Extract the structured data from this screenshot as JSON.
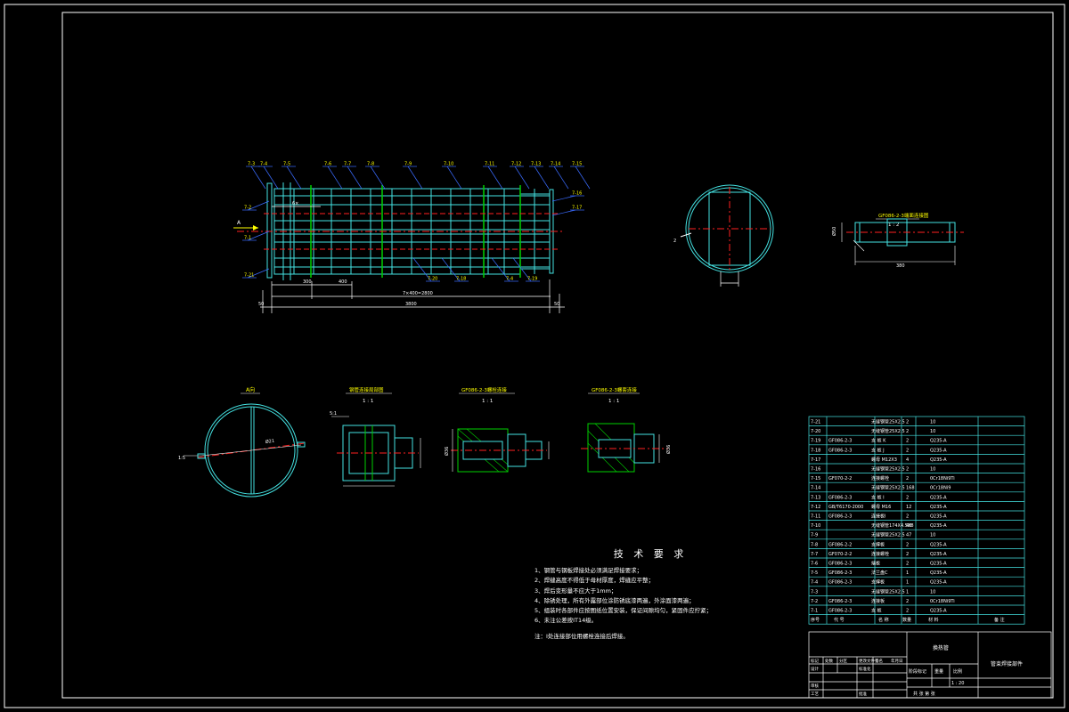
{
  "colors": {
    "background": "#000000",
    "outline": "#44e2e2",
    "dimension": "#ffffff",
    "centerline": "#ff2020",
    "callout": "#3a6bff",
    "hatch": "#00d000",
    "label_yellow": "#ffff00"
  },
  "main_view": {
    "callouts_top": [
      "7-3",
      "7-4",
      "7-5",
      "7-6",
      "7-7",
      "7-8",
      "7-9",
      "7-10",
      "7-11",
      "7-12",
      "7-13",
      "7-14",
      "7-15"
    ],
    "callouts_bottom": [
      "7-20",
      "7-18",
      "7-4",
      "7-19"
    ],
    "callouts_left": [
      "7-2",
      "7-1",
      "7-21"
    ],
    "callouts_right": [
      "7-16",
      "7-17"
    ],
    "dims": {
      "pitch_top": "6×",
      "seg1": "300",
      "seg2": "400",
      "span_inner": "7×400=2800",
      "overall": "3800",
      "end_left": "50",
      "end_right": "50"
    }
  },
  "section_circle": {
    "left_dim": "2"
  },
  "shaft_detail": {
    "title": "GF086-2-3端面连接图",
    "scale": "1 : 2",
    "dim_height": "Ø50",
    "dim_len": "380"
  },
  "view_a": {
    "title": "A向",
    "dia": "Ø21",
    "dim_left": "1:5"
  },
  "detail_1": {
    "title": "钢管连接局部图",
    "scale": "1 : 1",
    "dim_left": "5:1"
  },
  "detail_2": {
    "title": "GF086-2-3螺栓连接",
    "scale": "1 : 1",
    "dim_left": "Ø36"
  },
  "detail_3": {
    "title": "GF086-2-3螺套连接",
    "scale": "1 : 1",
    "dim_right": "Ø36"
  },
  "notes": {
    "title": "技 术 要 求",
    "lines": [
      "1、钢管与钢板焊接处必须满足焊接要求；",
      "2、焊缝高度不得低于母材厚度，焊缝应平整；",
      "3、焊后变形量不应大于1mm；",
      "4、除锈处理，所有外露部位涂防锈底漆两遍，外涂面漆两遍；",
      "5、组装时各部件应按图纸位置安装，保证间隙均匀，紧固件应拧紧；",
      "6、未注公差按IT14级。"
    ],
    "footnote": "注：Ⅰ处连接部位用螺栓连接后焊接。"
  },
  "bom": {
    "rows": [
      {
        "no": "7-21",
        "code": "",
        "name": "无缝钢管25X2.5",
        "qty": "2",
        "mat": "10"
      },
      {
        "no": "7-20",
        "code": "",
        "name": "无缝钢管25X2.5",
        "qty": "2",
        "mat": "10"
      },
      {
        "no": "7-19",
        "code": "GF086-2-3",
        "name": "支 板 K",
        "qty": "2",
        "mat": "Q235-A"
      },
      {
        "no": "7-18",
        "code": "GF086-2-3",
        "name": "支 板 J",
        "qty": "2",
        "mat": "Q235-A"
      },
      {
        "no": "7-17",
        "code": "",
        "name": "螺母 M12X3",
        "qty": "4",
        "mat": "Q235-A"
      },
      {
        "no": "7-16",
        "code": "",
        "name": "无缝钢管25X2.5",
        "qty": "2",
        "mat": "10"
      },
      {
        "no": "7-15",
        "code": "GF070-2-2",
        "name": "连接螺栓",
        "qty": "2",
        "mat": "0Cr18Ni9Ti"
      },
      {
        "no": "7-14",
        "code": "",
        "name": "无缝钢管25X2.5",
        "qty": "168",
        "mat": "0Cr18Ni9"
      },
      {
        "no": "7-13",
        "code": "GF086-2-3",
        "name": "支 板 I",
        "qty": "2",
        "mat": "Q235-A"
      },
      {
        "no": "7-12",
        "code": "GB/T6170-2000",
        "name": "螺母 M16",
        "qty": "12",
        "mat": "Q235-A"
      },
      {
        "no": "7-11",
        "code": "GF086-2-3",
        "name": "连接板Ⅰ",
        "qty": "2",
        "mat": "Q235-A"
      },
      {
        "no": "7-10",
        "code": "",
        "name": "无缝钢管174X4.5X8",
        "qty": "48",
        "mat": "Q235-A"
      },
      {
        "no": "7-9",
        "code": "",
        "name": "无缝钢管25X2.5",
        "qty": "47",
        "mat": "10"
      },
      {
        "no": "7-8",
        "code": "GF086-2-2",
        "name": "支撑板",
        "qty": "2",
        "mat": "Q235-A"
      },
      {
        "no": "7-7",
        "code": "GF070-2-2",
        "name": "连接螺栓",
        "qty": "2",
        "mat": "Q235-A"
      },
      {
        "no": "7-6",
        "code": "GF086-2-3",
        "name": "端板",
        "qty": "2",
        "mat": "Q235-A"
      },
      {
        "no": "7-5",
        "code": "GF086-2-3",
        "name": "法兰盘C",
        "qty": "1",
        "mat": "Q235-A"
      },
      {
        "no": "7-4",
        "code": "GF086-2-3",
        "name": "支撑板",
        "qty": "1",
        "mat": "Q235-A"
      },
      {
        "no": "7-3",
        "code": "",
        "name": "无缝钢管25X2.5",
        "qty": "1",
        "mat": "10"
      },
      {
        "no": "7-2",
        "code": "GF086-2-3",
        "name": "连接板",
        "qty": "2",
        "mat": "0Cr18Ni9Ti"
      },
      {
        "no": "7-1",
        "code": "GF086-2-3",
        "name": "支 板",
        "qty": "2",
        "mat": "Q235-A"
      }
    ],
    "header": [
      "序号",
      "代 号",
      "名 称",
      "数量",
      "材 料",
      "备 注"
    ]
  },
  "title_block": {
    "part_name": "换热管",
    "drawing_title": "管束焊接部件",
    "scale_label": "比例",
    "scale": "1 : 20",
    "weight_label": "重量",
    "stage_label": "阶段标记",
    "sheet_label": "共  张  第  张",
    "labels": [
      "标记",
      "处数",
      "分区",
      "更改文件号",
      "签名",
      "年月日",
      "设计",
      "标准化",
      "审核",
      "工艺",
      "批准"
    ]
  }
}
